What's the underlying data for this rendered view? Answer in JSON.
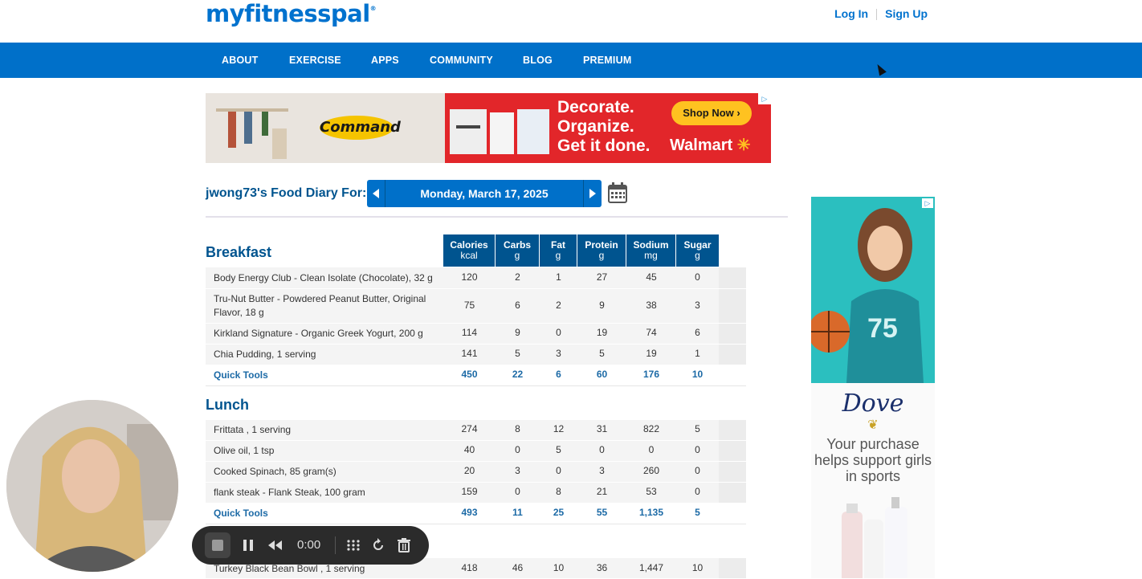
{
  "header": {
    "logo": "myfitnesspal",
    "login": "Log In",
    "signup": "Sign Up"
  },
  "nav": {
    "items": [
      "ABOUT",
      "EXERCISE",
      "APPS",
      "COMMUNITY",
      "BLOG",
      "PREMIUM"
    ]
  },
  "banner_ad": {
    "brand": "Command",
    "line1": "Decorate.",
    "line2": "Organize.",
    "line3": "Get it done.",
    "cta": "Shop Now",
    "retailer": "Walmart"
  },
  "diary": {
    "title": "jwong73's Food Diary For:",
    "date": "Monday, March 17, 2025"
  },
  "columns": [
    {
      "label": "Calories",
      "unit": "kcal"
    },
    {
      "label": "Carbs",
      "unit": "g"
    },
    {
      "label": "Fat",
      "unit": "g"
    },
    {
      "label": "Protein",
      "unit": "g"
    },
    {
      "label": "Sodium",
      "unit": "mg"
    },
    {
      "label": "Sugar",
      "unit": "g"
    }
  ],
  "meals": {
    "breakfast": {
      "title": "Breakfast",
      "items": [
        {
          "name": "Body Energy Club - Clean Isolate (Chocolate), 32 g",
          "values": [
            "120",
            "2",
            "1",
            "27",
            "45",
            "0"
          ]
        },
        {
          "name": "Tru-Nut Butter - Powdered Peanut Butter, Original Flavor, 18 g",
          "values": [
            "75",
            "6",
            "2",
            "9",
            "38",
            "3"
          ]
        },
        {
          "name": "Kirkland Signature - Organic Greek Yogurt, 200 g",
          "values": [
            "114",
            "9",
            "0",
            "19",
            "74",
            "6"
          ]
        },
        {
          "name": "Chia Pudding, 1 serving",
          "values": [
            "141",
            "5",
            "3",
            "5",
            "19",
            "1"
          ]
        }
      ],
      "totals_label": "Quick Tools",
      "totals": [
        "450",
        "22",
        "6",
        "60",
        "176",
        "10"
      ]
    },
    "lunch": {
      "title": "Lunch",
      "items": [
        {
          "name": "Frittata , 1 serving",
          "values": [
            "274",
            "8",
            "12",
            "31",
            "822",
            "5"
          ]
        },
        {
          "name": "Olive oil, 1 tsp",
          "values": [
            "40",
            "0",
            "5",
            "0",
            "0",
            "0"
          ]
        },
        {
          "name": "Cooked Spinach, 85 gram(s)",
          "values": [
            "20",
            "3",
            "0",
            "3",
            "260",
            "0"
          ]
        },
        {
          "name": "flank steak - Flank Steak, 100 gram",
          "values": [
            "159",
            "0",
            "8",
            "21",
            "53",
            "0"
          ]
        }
      ],
      "totals_label": "Quick Tools",
      "totals": [
        "493",
        "11",
        "25",
        "55",
        "1,135",
        "5"
      ]
    },
    "dinner": {
      "items": [
        {
          "name": "Turkey Black Bean Bowl , 1 serving",
          "values": [
            "418",
            "46",
            "10",
            "36",
            "1,447",
            "10"
          ]
        }
      ]
    }
  },
  "side_ad": {
    "jersey": "75",
    "brand": "Dove",
    "text": "Your purchase helps support girls in sports"
  },
  "recorder": {
    "time": "0:00"
  }
}
